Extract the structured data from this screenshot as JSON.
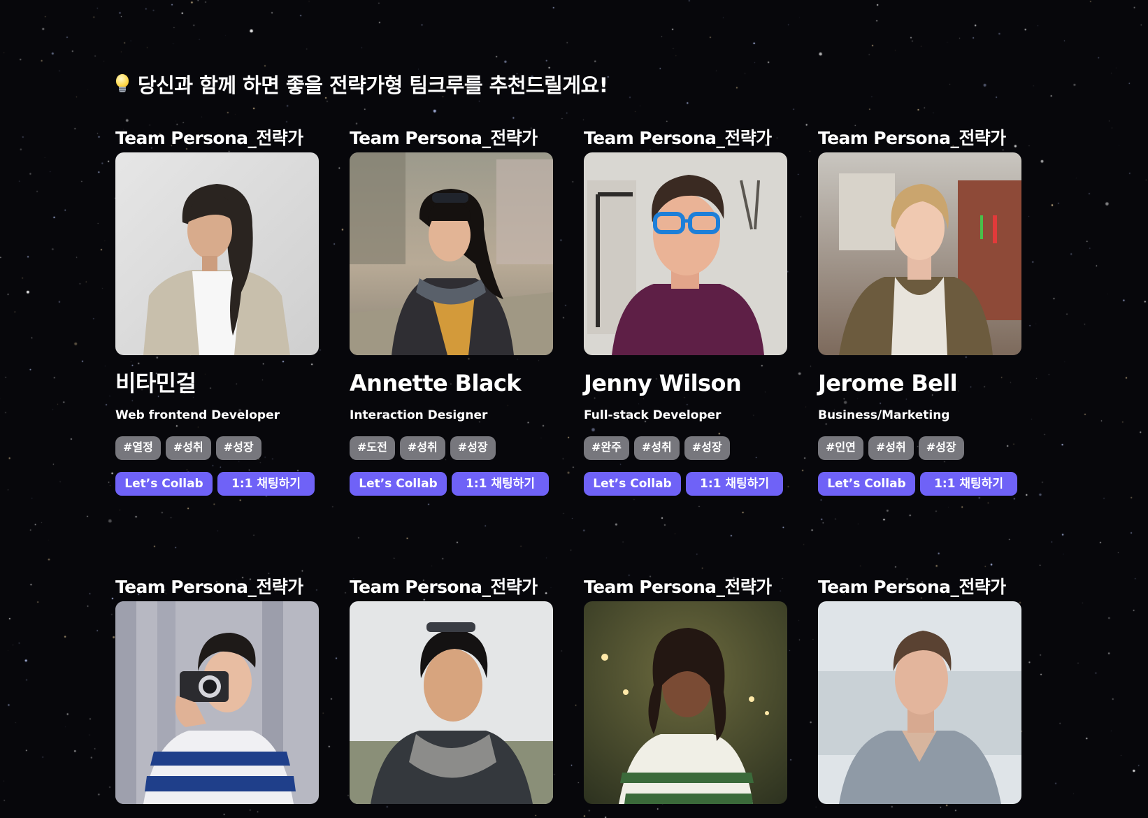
{
  "page": {
    "heading": "당신과 함께 하면 좋을 전략가형 팀크루를 추천드릴게요!",
    "heading_icon": "lightbulb-icon",
    "background_color": "#07070b"
  },
  "colors": {
    "primary_button": "#6f62f7",
    "tag_background": "#77777d"
  },
  "buttons": {
    "collab": "Let’s Collab",
    "chat": "1:1 채팅하기"
  },
  "cards": [
    {
      "label": "Team Persona_전략가",
      "name": "비타민걸",
      "role": "Web frontend Developer",
      "tags": [
        "#열정",
        "#성취",
        "#성장"
      ],
      "photo_description": "portrait-woman-braid"
    },
    {
      "label": "Team Persona_전략가",
      "name": "Annette Black",
      "role": "Interaction Designer",
      "tags": [
        "#도전",
        "#성취",
        "#성장"
      ],
      "photo_description": "portrait-woman-street"
    },
    {
      "label": "Team Persona_전략가",
      "name": "Jenny Wilson",
      "role": "Full-stack Developer",
      "tags": [
        "#완주",
        "#성취",
        "#성장"
      ],
      "photo_description": "portrait-man-blue-glasses"
    },
    {
      "label": "Team Persona_전략가",
      "name": "Jerome Bell",
      "role": "Business/Marketing",
      "tags": [
        "#인연",
        "#성취",
        "#성장"
      ],
      "photo_description": "portrait-woman-city"
    },
    {
      "label": "Team Persona_전략가",
      "photo_description": "portrait-man-camera"
    },
    {
      "label": "Team Persona_전략가",
      "photo_description": "portrait-man-scarf"
    },
    {
      "label": "Team Persona_전략가",
      "photo_description": "portrait-woman-lights"
    },
    {
      "label": "Team Persona_전략가",
      "photo_description": "portrait-man-shirt"
    }
  ]
}
